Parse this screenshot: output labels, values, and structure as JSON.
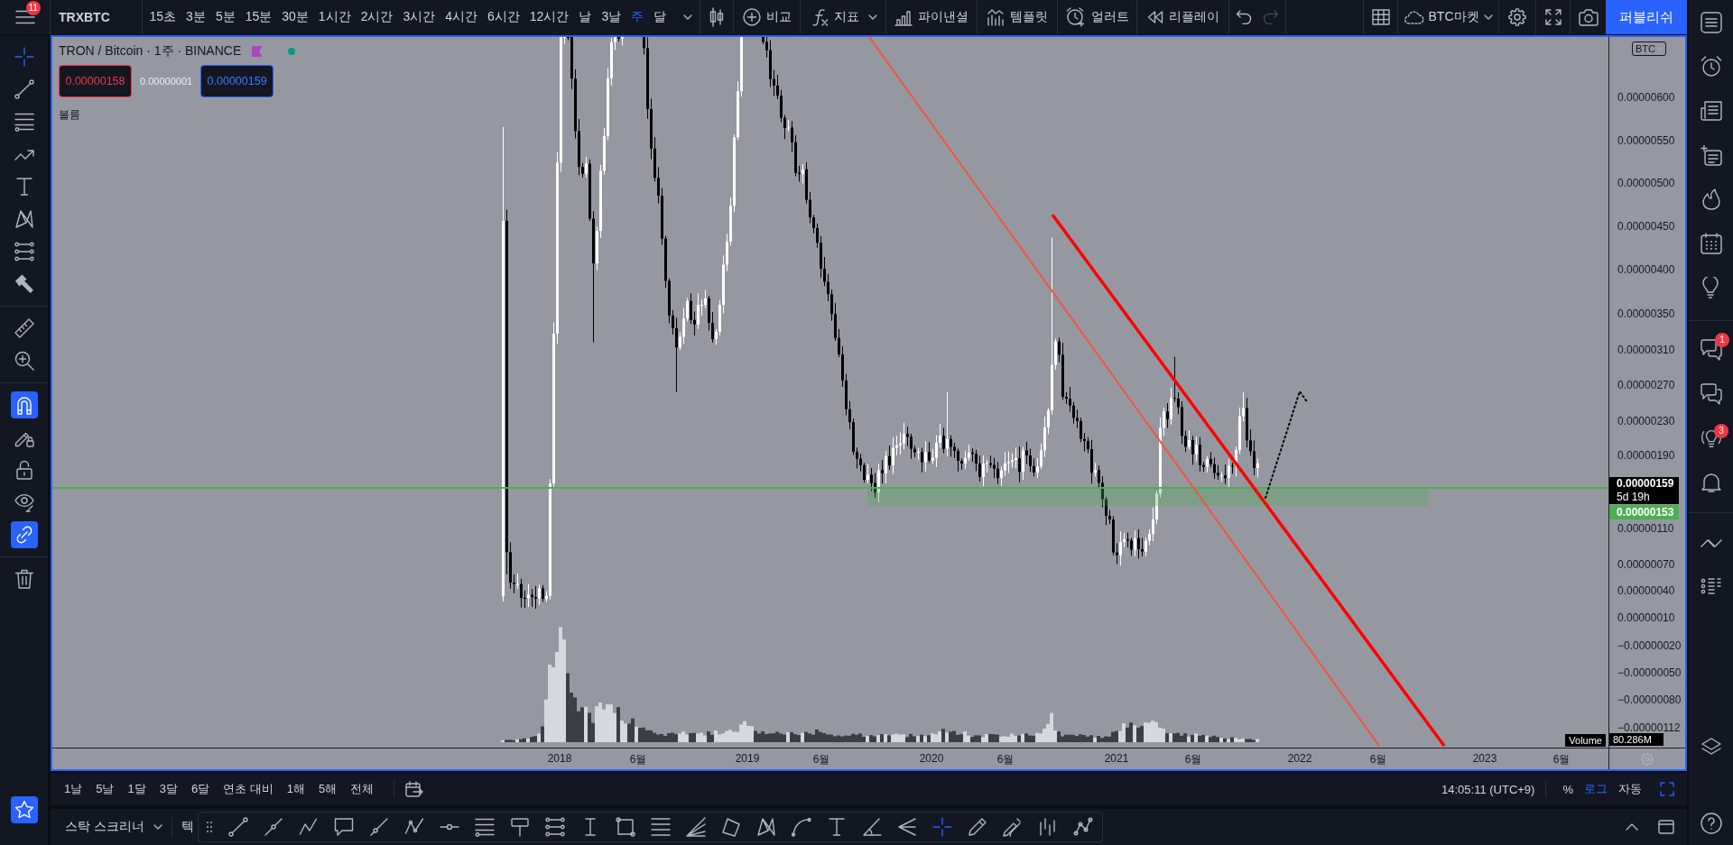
{
  "top_toolbar": {
    "menu_badge": "11",
    "symbol": "TRXBTC",
    "intervals": [
      {
        "label": "15초",
        "selected": false
      },
      {
        "label": "3분",
        "selected": false
      },
      {
        "label": "5분",
        "selected": false
      },
      {
        "label": "15분",
        "selected": false
      },
      {
        "label": "30분",
        "selected": false
      },
      {
        "label": "1시간",
        "selected": false
      },
      {
        "label": "2시간",
        "selected": false
      },
      {
        "label": "3시간",
        "selected": false
      },
      {
        "label": "4시간",
        "selected": false
      },
      {
        "label": "6시간",
        "selected": false
      },
      {
        "label": "12시간",
        "selected": false
      },
      {
        "label": "날",
        "selected": false
      },
      {
        "label": "3날",
        "selected": false
      },
      {
        "label": "주",
        "selected": true
      },
      {
        "label": "달",
        "selected": false
      }
    ],
    "actions": [
      {
        "kind": "compare",
        "label": "비교"
      },
      {
        "kind": "indicators",
        "label": "지표"
      },
      {
        "kind": "financials",
        "label": "파이낸셜"
      },
      {
        "kind": "templates",
        "label": "템플릿"
      },
      {
        "kind": "alert",
        "label": "얼러트"
      },
      {
        "kind": "replay",
        "label": "리플레이"
      }
    ],
    "history": [
      {
        "kind": "undo",
        "disabled": false
      },
      {
        "kind": "redo",
        "disabled": true
      }
    ],
    "layout": "BTC마켓",
    "publish": "퍼블리쉬"
  },
  "left_toolbar": {
    "tool_groups": [
      [
        {
          "kind": "crosshair",
          "selected": true
        },
        {
          "kind": "trend",
          "selected": false
        },
        {
          "kind": "fib",
          "selected": false
        },
        {
          "kind": "path",
          "selected": false
        },
        {
          "kind": "text",
          "selected": false
        },
        {
          "kind": "pattern",
          "selected": false
        },
        {
          "kind": "forecast",
          "selected": false
        },
        {
          "kind": "hammer",
          "selected": false
        }
      ],
      [
        {
          "kind": "ruler",
          "selected": false
        },
        {
          "kind": "zoom",
          "selected": false
        }
      ]
    ],
    "toggles": [
      {
        "kind": "magnet",
        "on": true
      },
      {
        "kind": "drawlock",
        "on": false
      },
      {
        "kind": "lock",
        "on": false
      },
      {
        "kind": "hide",
        "on": false
      },
      {
        "kind": "sync",
        "on": true
      }
    ],
    "favorites": {
      "on": true
    }
  },
  "chart": {
    "legend": {
      "title": "TRON / Bitcoin · 1주 · BINANCE",
      "quotes": [
        {
          "kind": "sell",
          "text": "0.00000158"
        },
        {
          "kind": "spread",
          "text": "0.00000001"
        },
        {
          "kind": "buy",
          "text": "0.00000159"
        }
      ],
      "indicator": "볼륨"
    },
    "currency": "BTC",
    "price_ticks": [
      "0.00000600",
      "0.00000550",
      "0.00000500",
      "0.00000450",
      "0.00000400",
      "0.00000350",
      "0.00000310",
      "0.00000270",
      "0.00000230",
      "0.00000190",
      "0.00000110",
      "0.00000070",
      "0.00000040",
      "0.00000010",
      "−0.00000020",
      "−0.00000050",
      "−0.00000080",
      "−0.00000112"
    ],
    "last_price": "0.00000159",
    "countdown": "5d 19h",
    "line_price": "0.00000153",
    "volume_label": "Volume",
    "volume_value": "80.286M",
    "time_ticks": [
      "2018",
      "6월",
      "2019",
      "6월",
      "2020",
      "6월",
      "2021",
      "6월",
      "2022",
      "6월",
      "2023",
      "6월"
    ]
  },
  "right_sidebar": {
    "chat_badge": "1",
    "ideas_badge": "3"
  },
  "bottom_bar": {
    "ranges": [
      "1날",
      "5날",
      "1달",
      "3달",
      "6달",
      "연초 대비",
      "1해",
      "5해",
      "전체"
    ],
    "clock": "14:05:11 (UTC+9)",
    "scale_modes": [
      {
        "label": "%",
        "selected": false
      },
      {
        "label": "로그",
        "selected": true
      },
      {
        "label": "자동",
        "selected": false
      }
    ],
    "auto_fit": {
      "on": true
    }
  },
  "bottom_panel": {
    "tabs": [
      {
        "kind": "dropdown",
        "label": "스탁 스크리너"
      },
      {
        "kind": "plain",
        "label": "텍"
      }
    ],
    "drawing_tools": [
      {
        "kind": "trend",
        "selected": false
      },
      {
        "kind": "info",
        "selected": false
      },
      {
        "kind": "abcd",
        "selected": false
      },
      {
        "kind": "callout",
        "selected": false
      },
      {
        "kind": "ray",
        "selected": false
      },
      {
        "kind": "abc",
        "selected": false
      },
      {
        "kind": "hline",
        "selected": false
      },
      {
        "kind": "fib",
        "selected": false
      },
      {
        "kind": "sign",
        "selected": false
      },
      {
        "kind": "forecast",
        "selected": false
      },
      {
        "kind": "ibeam",
        "selected": false
      },
      {
        "kind": "rect",
        "selected": false
      },
      {
        "kind": "stack",
        "selected": false
      },
      {
        "kind": "fan",
        "selected": false
      },
      {
        "kind": "polygon",
        "selected": false
      },
      {
        "kind": "pattern",
        "selected": false
      },
      {
        "kind": "arc",
        "selected": false
      },
      {
        "kind": "text",
        "selected": false
      },
      {
        "kind": "angle",
        "selected": false
      },
      {
        "kind": "fork",
        "selected": false
      },
      {
        "kind": "crosshair",
        "selected": true
      },
      {
        "kind": "pen",
        "selected": false
      },
      {
        "kind": "pens",
        "selected": false
      },
      {
        "kind": "bars",
        "selected": false
      },
      {
        "kind": "nodes",
        "selected": false
      }
    ]
  }
}
